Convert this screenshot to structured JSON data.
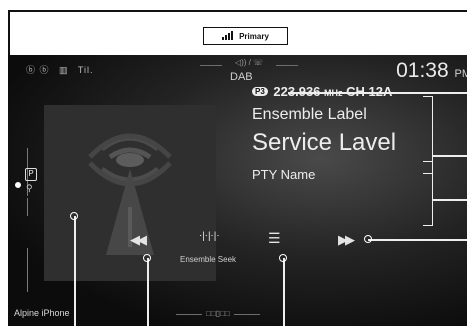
{
  "status_bar": {
    "icons_text": [
      "ⓑ ⓑ",
      "▥",
      "Til."
    ],
    "source_indicator": "◁)) / ☏",
    "source_label": "DAB",
    "clock": "01:38",
    "clock_suffix": "PM"
  },
  "reception": {
    "badge_label": "Primary"
  },
  "station": {
    "program_badge": "P3",
    "frequency": "223.936",
    "frequency_unit": "MHz",
    "channel": "CH 12A",
    "ensemble_label": "Ensemble Label",
    "service_label": "Service Lavel",
    "pty_name": "PTY Name"
  },
  "controls": {
    "seek_mode_label": "Ensemble Seek"
  },
  "footer": {
    "device_name": "Alpine iPhone"
  },
  "icons": [
    "broadcast-icon",
    "previous-icon",
    "seek-icon",
    "list-icon",
    "next-icon",
    "preset-icon",
    "search-icon",
    "signal-bars-icon"
  ]
}
